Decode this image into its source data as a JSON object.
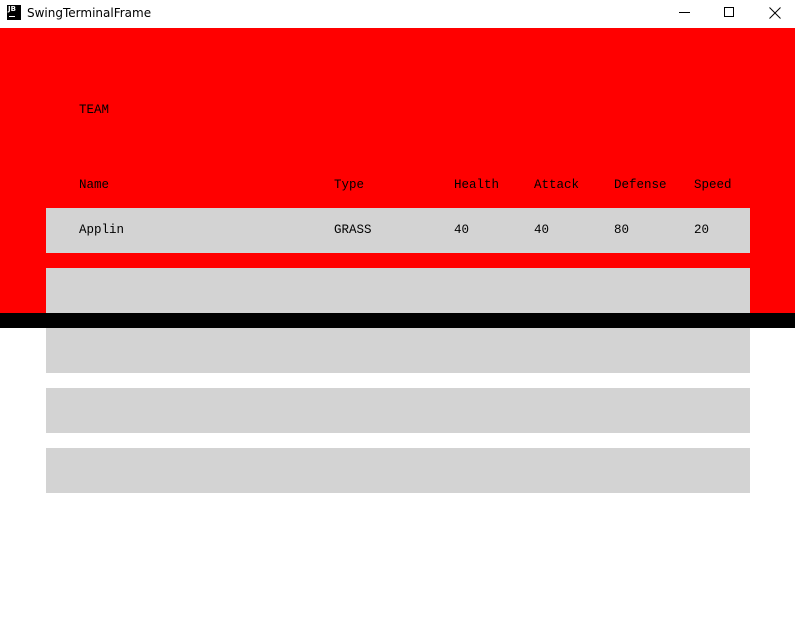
{
  "window": {
    "title": "SwingTerminalFrame",
    "icon_label": "JB"
  },
  "panel": {
    "heading": "TEAM",
    "accent_color": "#ff0000",
    "slot_color": "#d3d3d3"
  },
  "table": {
    "headers": {
      "name": "Name",
      "type": "Type",
      "health": "Health",
      "attack": "Attack",
      "defense": "Defense",
      "speed": "Speed"
    },
    "rows": [
      {
        "name": "Applin",
        "type": "GRASS",
        "health": "40",
        "attack": "40",
        "defense": "80",
        "speed": "20"
      },
      {
        "name": "",
        "type": "",
        "health": "",
        "attack": "",
        "defense": "",
        "speed": ""
      },
      {
        "name": "",
        "type": "",
        "health": "",
        "attack": "",
        "defense": "",
        "speed": ""
      },
      {
        "name": "",
        "type": "",
        "health": "",
        "attack": "",
        "defense": "",
        "speed": ""
      },
      {
        "name": "",
        "type": "",
        "health": "",
        "attack": "",
        "defense": "",
        "speed": ""
      }
    ]
  }
}
